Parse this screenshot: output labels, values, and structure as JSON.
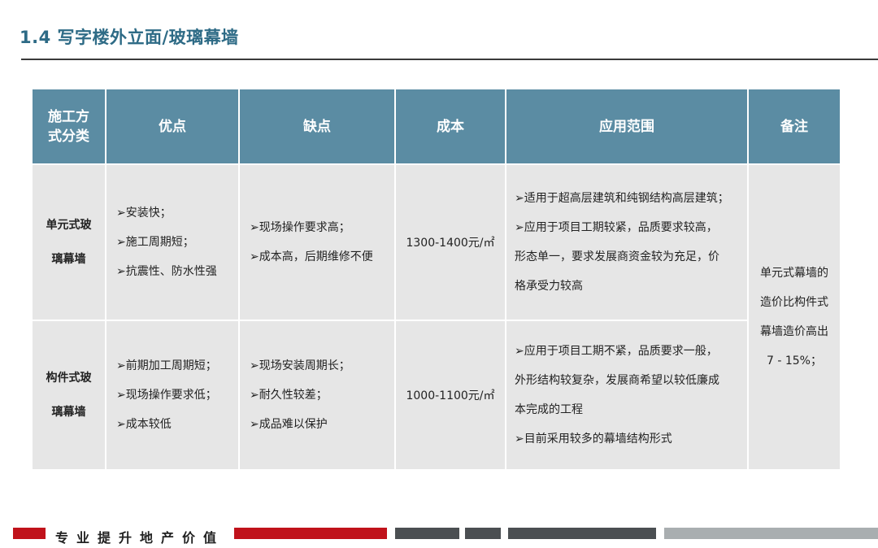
{
  "header": {
    "title": "1.4 写字楼外立面/玻璃幕墙"
  },
  "table": {
    "headers": [
      "施工方\n式分类",
      "优点",
      "缺点",
      "成本",
      "应用范围",
      "备注"
    ],
    "rows": [
      {
        "category": "单元式玻\n璃幕墙",
        "pros": [
          "➢安装快；",
          "➢施工周期短；",
          "➢抗震性、防水性强"
        ],
        "cons": [
          "➢现场操作要求高；",
          "➢成本高，后期维修不便"
        ],
        "cost": "1300-1400元/㎡",
        "range": [
          "➢适用于超高层建筑和纯钢结构高层建筑；",
          "➢应用于项目工期较紧，品质要求较高，",
          "形态单一，要求发展商资金较为充足，价",
          "格承受力较高"
        ]
      },
      {
        "category": "构件式玻\n璃幕墙",
        "pros": [
          "➢前期加工周期短；",
          "➢现场操作要求低；",
          "➢成本较低"
        ],
        "cons": [
          "➢现场安装周期长；",
          "➢耐久性较差；",
          "➢成品难以保护"
        ],
        "cost": "1000-1100元/㎡",
        "range": [
          "➢应用于项目工期不紧，品质要求一般，",
          "外形结构较复杂，发展商希望以较低廉成",
          "本完成的工程",
          "➢目前采用较多的幕墙结构形式"
        ]
      }
    ],
    "note": [
      "单元式幕墙的",
      "造价比构件式",
      "幕墙造价高出",
      "7 - 15%；"
    ]
  },
  "footer": {
    "slogan": "专业提升地产价值",
    "colors": {
      "red": "#c0121b",
      "dark": "#4b4f52",
      "gray": "#a9aeb0"
    }
  }
}
